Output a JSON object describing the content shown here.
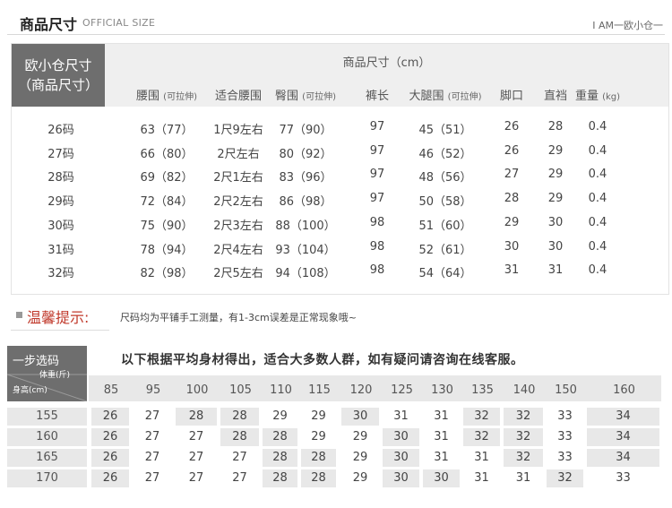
{
  "header": {
    "title": "商品尺寸",
    "subtitle": "OFFICIAL SIZE",
    "right": "I AM一欧小仓一"
  },
  "size_table": {
    "left_label_line1": "欧小仓尺寸",
    "left_label_line2": "（商品尺寸）",
    "header_title": "商品尺寸（cm）",
    "columns": [
      {
        "label": "腰围",
        "note": "(可拉伸)"
      },
      {
        "label": "适合腰围",
        "note": ""
      },
      {
        "label": "臀围",
        "note": "(可拉伸)"
      },
      {
        "label": "裤长",
        "note": ""
      },
      {
        "label": "大腿围",
        "note": "(可拉伸)"
      },
      {
        "label": "脚口",
        "note": ""
      },
      {
        "label": "直裆",
        "note": ""
      },
      {
        "label": "重量",
        "note": "(kg)"
      }
    ],
    "rows": [
      {
        "size": "26码",
        "cells": [
          "63（77）",
          "1尺9左右",
          "77（90）",
          "97",
          "45（51）",
          "26",
          "28",
          "0.4"
        ]
      },
      {
        "size": "27码",
        "cells": [
          "66（80）",
          "2尺左右",
          "80（92）",
          "97",
          "46（52）",
          "26",
          "29",
          "0.4"
        ]
      },
      {
        "size": "28码",
        "cells": [
          "69（82）",
          "2尺1左右",
          "83（96）",
          "97",
          "48（56）",
          "27",
          "29",
          "0.4"
        ]
      },
      {
        "size": "29码",
        "cells": [
          "72（84）",
          "2尺2左右",
          "86（98）",
          "97",
          "50（58）",
          "28",
          "29",
          "0.4"
        ]
      },
      {
        "size": "30码",
        "cells": [
          "75（90）",
          "2尺3左右",
          "88（100）",
          "98",
          "51（60）",
          "29",
          "30",
          "0.4"
        ]
      },
      {
        "size": "31码",
        "cells": [
          "78（94）",
          "2尺4左右",
          "93（104）",
          "98",
          "52（61）",
          "30",
          "30",
          "0.4"
        ]
      },
      {
        "size": "32码",
        "cells": [
          "82（98）",
          "2尺5左右",
          "94（108）",
          "98",
          "54（64）",
          "31",
          "31",
          "0.4"
        ]
      }
    ]
  },
  "tip": {
    "title": "温馨提示:",
    "text": "尺码均为平铺手工测量，有1-3cm误差是正常现象哦~"
  },
  "recommend": {
    "corner_title": "一步选码",
    "corner_weight": "体重(斤)",
    "corner_height": "身高(cm)",
    "note": "以下根据平均身材得出，适合大多数人群，如有疑问请咨询在线客服。",
    "weights": [
      "85",
      "95",
      "100",
      "105",
      "110",
      "115",
      "120",
      "125",
      "130",
      "135",
      "140",
      "150",
      "160"
    ],
    "rows": [
      {
        "height": "155",
        "cells": [
          "26",
          "27",
          "28",
          "28",
          "29",
          "29",
          "30",
          "31",
          "31",
          "32",
          "32",
          "33",
          "34"
        ]
      },
      {
        "height": "160",
        "cells": [
          "26",
          "27",
          "27",
          "28",
          "28",
          "29",
          "29",
          "30",
          "31",
          "32",
          "32",
          "33",
          "34"
        ]
      },
      {
        "height": "165",
        "cells": [
          "26",
          "27",
          "27",
          "27",
          "28",
          "28",
          "29",
          "30",
          "31",
          "31",
          "32",
          "33",
          "34"
        ]
      },
      {
        "height": "170",
        "cells": [
          "26",
          "27",
          "27",
          "27",
          "28",
          "28",
          "29",
          "30",
          "30",
          "31",
          "31",
          "32",
          "33"
        ]
      }
    ],
    "colors": {
      "corner": "#6e6e6e",
      "shade": "#e8e8e8"
    }
  }
}
